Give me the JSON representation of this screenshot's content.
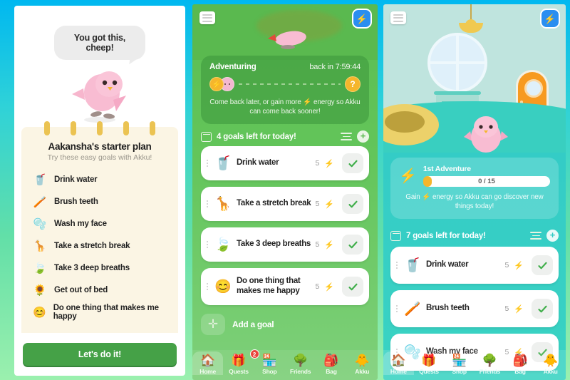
{
  "panel1": {
    "speech_bubble": "You got this, cheep!",
    "notebook": {
      "title": "Aakansha's starter plan",
      "subtitle": "Try these easy goals with Akku!",
      "items": [
        {
          "emoji": "🥤",
          "label": "Drink water"
        },
        {
          "emoji": "🪥",
          "label": "Brush teeth"
        },
        {
          "emoji": "🫧",
          "label": "Wash my face"
        },
        {
          "emoji": "🦒",
          "label": "Take a stretch break"
        },
        {
          "emoji": "🍃",
          "label": "Take 3 deep breaths"
        },
        {
          "emoji": "🌻",
          "label": "Get out of bed"
        },
        {
          "emoji": "😊",
          "label": "Do one thing that makes me happy"
        }
      ]
    },
    "cta_label": "Let's do it!"
  },
  "panel2": {
    "menu_icon": "hamburger-icon",
    "energy_icon": "bolt-icon",
    "adventure": {
      "title": "Adventuring",
      "timer": "back in 7:59:44",
      "help_label": "?",
      "note": "Come back later, or gain more ⚡ energy so Akku can come back sooner!"
    },
    "goals_header": {
      "text": "4 goals left for today!",
      "filter_icon": "filter-icon",
      "add_icon": "plus-circle-icon"
    },
    "goals": [
      {
        "emoji": "🥤",
        "label": "Drink water",
        "points": "5",
        "bolt": "⚡"
      },
      {
        "emoji": "🦒",
        "label": "Take a stretch break",
        "points": "5",
        "bolt": "⚡"
      },
      {
        "emoji": "🍃",
        "label": "Take 3 deep breaths",
        "points": "5",
        "bolt": "⚡"
      },
      {
        "emoji": "😊",
        "label": "Do one thing that makes me happy",
        "points": "5",
        "bolt": "⚡"
      }
    ],
    "add_goal_label": "Add a goal",
    "nav": [
      {
        "icon": "🏠",
        "label": "Home",
        "badge": ""
      },
      {
        "icon": "🎁",
        "label": "Quests",
        "badge": "2"
      },
      {
        "icon": "🏪",
        "label": "Shop",
        "badge": ""
      },
      {
        "icon": "🌳",
        "label": "Friends",
        "badge": ""
      },
      {
        "icon": "🎒",
        "label": "Bag",
        "badge": ""
      },
      {
        "icon": "🐥",
        "label": "Akku",
        "badge": ""
      }
    ]
  },
  "panel3": {
    "menu_icon": "hamburger-icon",
    "energy_icon": "bolt-icon",
    "adventure": {
      "bolt": "⚡",
      "title": "1st Adventure",
      "progress_text": "0 / 15",
      "progress_current": 0,
      "progress_max": 15,
      "note": "Gain ⚡ energy so Akku can go discover new things today!"
    },
    "goals_header": {
      "text": "7 goals left for today!",
      "filter_icon": "filter-icon",
      "add_icon": "plus-circle-icon"
    },
    "goals": [
      {
        "emoji": "🥤",
        "label": "Drink water",
        "points": "5",
        "bolt": "⚡"
      },
      {
        "emoji": "🪥",
        "label": "Brush teeth",
        "points": "5",
        "bolt": "⚡"
      },
      {
        "emoji": "🫧",
        "label": "Wash my face",
        "points": "5",
        "bolt": "⚡"
      }
    ],
    "nav": [
      {
        "icon": "🏠",
        "label": "Home",
        "badge": ""
      },
      {
        "icon": "🎁",
        "label": "Quests",
        "badge": ""
      },
      {
        "icon": "🏪",
        "label": "Shop",
        "badge": ""
      },
      {
        "icon": "🌳",
        "label": "Friends",
        "badge": ""
      },
      {
        "icon": "🎒",
        "label": "Bag",
        "badge": ""
      },
      {
        "icon": "🐥",
        "label": "Akku",
        "badge": ""
      }
    ]
  },
  "colors": {
    "background_top": "#00b8f0",
    "background_bottom": "#9bf0ae",
    "panel2_green": "#5ab94f",
    "panel3_teal": "#33cbc3",
    "cta_green": "#45a147",
    "notebook_cream": "#fbf5e4",
    "accent_amber": "#f5b62c",
    "energy_blue": "#2a8ef0",
    "badge_red": "#e8453c"
  }
}
